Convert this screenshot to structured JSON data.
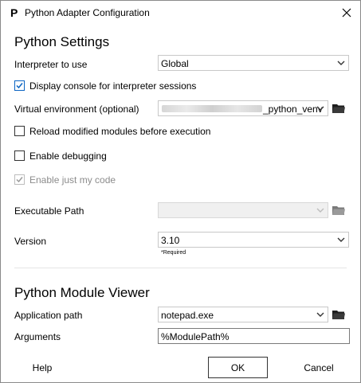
{
  "window": {
    "title": "Python Adapter Configuration",
    "app_icon_glyph": "P"
  },
  "python_settings": {
    "title": "Python Settings",
    "interpreter_label": "Interpreter to use",
    "interpreter_value": "Global",
    "display_console_label": "Display console for interpreter sessions",
    "display_console_checked": true,
    "venv_label": "Virtual environment (optional)",
    "venv_value": "_python_venv",
    "reload_label": "Reload modified modules before execution",
    "reload_checked": false,
    "debugging_label": "Enable debugging",
    "debugging_checked": false,
    "just_my_code_label": "Enable just my code",
    "just_my_code_checked": true,
    "executable_label": "Executable Path",
    "executable_value": "",
    "version_label": "Version",
    "version_value": "3.10",
    "required_note": "*Required"
  },
  "module_viewer": {
    "title": "Python Module Viewer",
    "app_path_label": "Application path",
    "app_path_value": "notepad.exe",
    "arguments_label": "Arguments",
    "arguments_value": "%ModulePath%"
  },
  "footer": {
    "help_label": "Help",
    "ok_label": "OK",
    "cancel_label": "Cancel"
  },
  "colors": {
    "accent": "#0a64c2",
    "folder": "#1e1e1e"
  }
}
